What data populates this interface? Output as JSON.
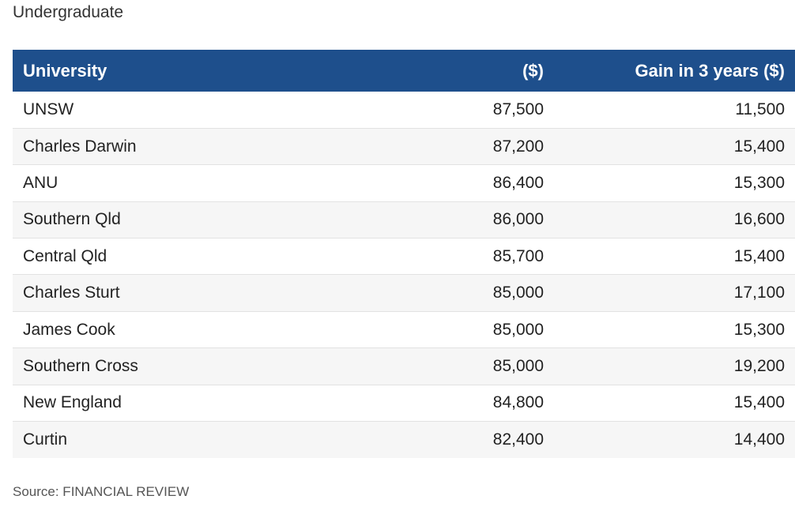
{
  "subtitle": "Undergraduate",
  "table": {
    "headers": [
      "University",
      "($)",
      "Gain in 3 years ($)"
    ],
    "rows": [
      [
        "UNSW",
        "87,500",
        "11,500"
      ],
      [
        "Charles Darwin",
        "87,200",
        "15,400"
      ],
      [
        "ANU",
        "86,400",
        "15,300"
      ],
      [
        "Southern Qld",
        "86,000",
        "16,600"
      ],
      [
        "Central Qld",
        "85,700",
        "15,400"
      ],
      [
        "Charles Sturt",
        "85,000",
        "17,100"
      ],
      [
        "James Cook",
        "85,000",
        "15,300"
      ],
      [
        "Southern Cross",
        "85,000",
        "19,200"
      ],
      [
        "New England",
        "84,800",
        "15,400"
      ],
      [
        "Curtin",
        "82,400",
        "14,400"
      ]
    ]
  },
  "source": "Source: FINANCIAL REVIEW",
  "colors": {
    "header_background": "#1e4f8c",
    "header_text": "#ffffff",
    "stripe_row": "#f6f6f6"
  }
}
